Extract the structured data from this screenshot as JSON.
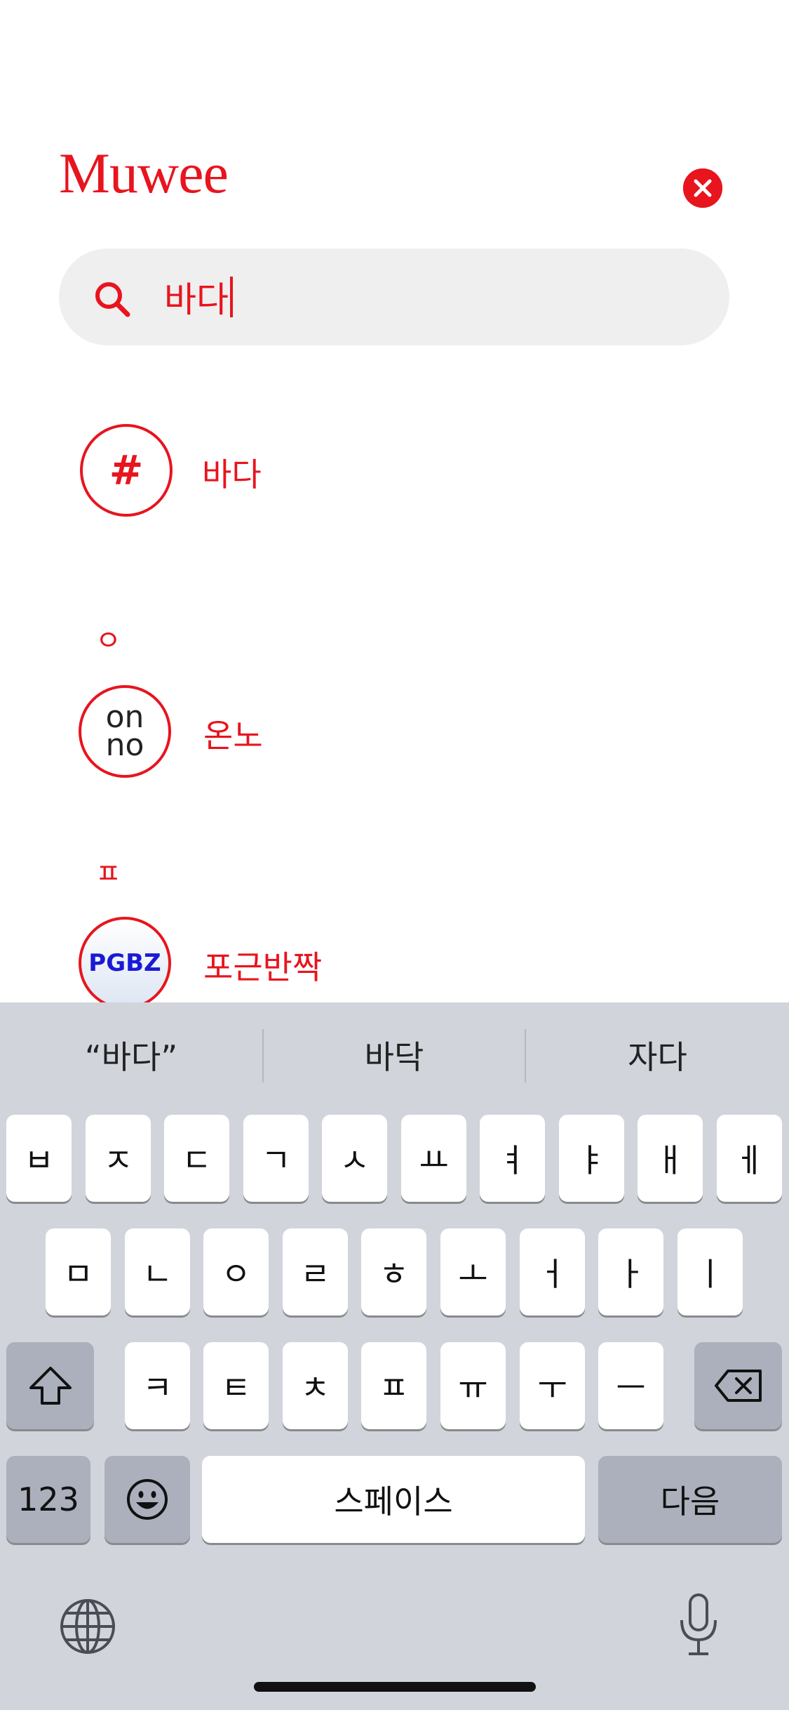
{
  "app": {
    "logo": "Muwee"
  },
  "search": {
    "value": "바다"
  },
  "results": [
    {
      "section": "",
      "avatar_text": "#",
      "label": "바다"
    },
    {
      "section": "ㅇ",
      "avatar_text_line1": "on",
      "avatar_text_line2": "no",
      "label": "온노"
    },
    {
      "section": "ㅍ",
      "avatar_text": "PGBZ",
      "label": "포근반짝"
    }
  ],
  "keyboard": {
    "suggestions": [
      "“바다”",
      "바닥",
      "자다"
    ],
    "row1": [
      "ㅂ",
      "ㅈ",
      "ㄷ",
      "ㄱ",
      "ㅅ",
      "ㅛ",
      "ㅕ",
      "ㅑ",
      "ㅐ",
      "ㅔ"
    ],
    "row2": [
      "ㅁ",
      "ㄴ",
      "ㅇ",
      "ㄹ",
      "ㅎ",
      "ㅗ",
      "ㅓ",
      "ㅏ",
      "ㅣ"
    ],
    "row3": [
      "ㅋ",
      "ㅌ",
      "ㅊ",
      "ㅍ",
      "ㅠ",
      "ㅜ",
      "ㅡ"
    ],
    "numbers_key": "123",
    "space_key": "스페이스",
    "return_key": "다음",
    "icons": [
      "shift-icon",
      "backspace-icon",
      "emoji-icon",
      "globe-icon",
      "microphone-icon"
    ]
  },
  "colors": {
    "accent": "#e8141e",
    "search_bg": "#efefef",
    "keyboard_bg": "#d1d4db",
    "pgbz_text": "#1a1ad6"
  }
}
